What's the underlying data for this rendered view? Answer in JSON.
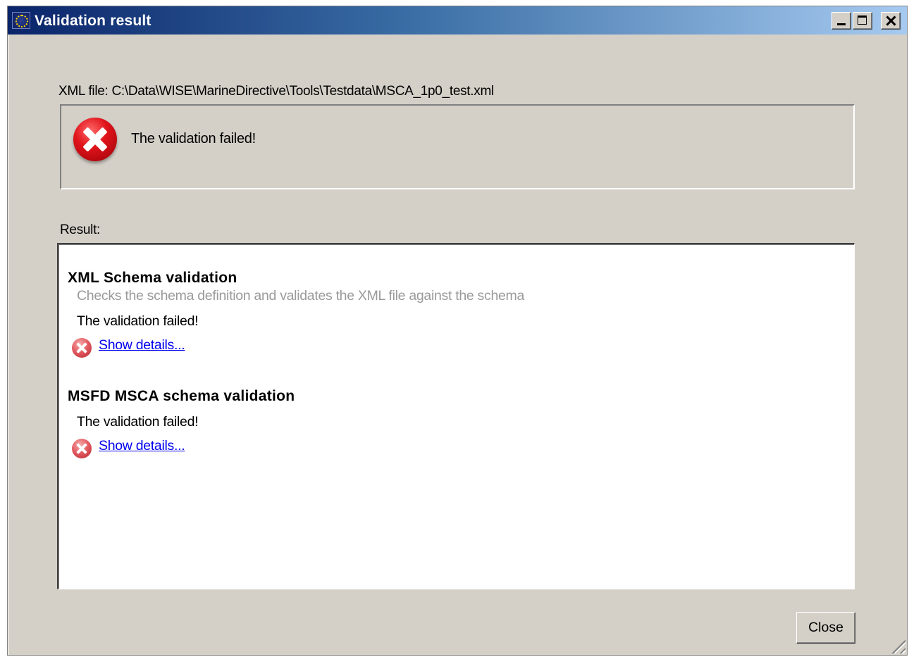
{
  "window": {
    "title": "Validation result",
    "controls": {
      "minimize": "minimize",
      "maximize": "maximize",
      "close": "close"
    }
  },
  "file": {
    "label": "XML file: C:\\Data\\WISE\\MarineDirective\\Tools\\Testdata\\MSCA_1p0_test.xml"
  },
  "status": {
    "icon": "error-icon",
    "text": "The validation failed!"
  },
  "result": {
    "label": "Result:",
    "sections": [
      {
        "title": "XML Schema validation",
        "description": "Checks the schema definition and validates the XML file against the schema",
        "result_text": "The validation failed!",
        "link_text": "Show details...",
        "icon": "error-icon"
      },
      {
        "title": "MSFD MSCA schema validation",
        "description": "",
        "result_text": "The validation failed!",
        "link_text": "Show details...",
        "icon": "error-icon"
      }
    ]
  },
  "buttons": {
    "close_label": "Close"
  },
  "colors": {
    "title_gradient_start": "#0a246a",
    "title_gradient_end": "#a6caf0",
    "error_red": "#e0141b",
    "link": "#0000ee"
  }
}
